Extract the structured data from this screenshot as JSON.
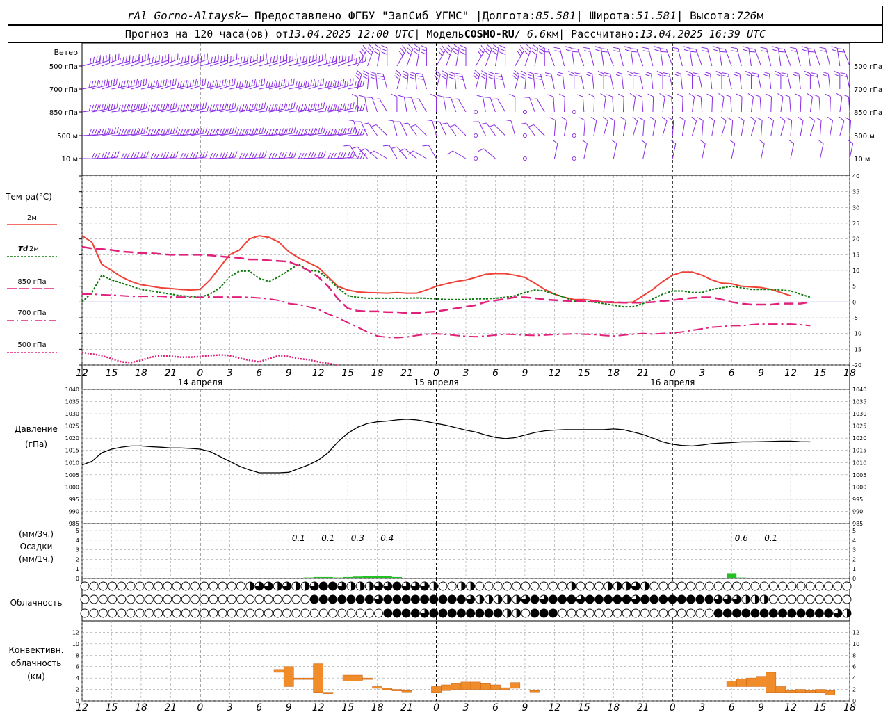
{
  "header": {
    "line1": {
      "station": "rAl_Gorno-Altaysk",
      "provider": " — Предоставлено ФГБУ \"ЗапСиб УГМС\" | ",
      "lon_label": "Долгота: ",
      "lon": "85.581",
      "lat_label": " | Широта: ",
      "lat": "51.581",
      "alt_label": " | Высота: ",
      "alt": "726",
      "alt_unit": "м"
    },
    "line2": {
      "forecast_label": "Прогноз на 120 часа(ов) от ",
      "forecast_time": "13.04.2025 12:00 UTC",
      "model_label": " | Модель ",
      "model": "COSMO-RU",
      "res": " / 6.6",
      "res_unit": "км",
      "computed_label": " | Рассчитано: ",
      "computed_time": "13.04.2025 16:39 UTC"
    }
  },
  "colors": {
    "wind": "#8a2be2",
    "t2m": "#ef4136",
    "td2m": "#0a7a0a",
    "t850": "#e0207a",
    "t700": "#e0207a",
    "t500": "#e0207a",
    "pressure": "#000000",
    "precip": "#22c022",
    "conv": "#f08c2a",
    "zero": "#5050e0",
    "grid": "#a0a0a0"
  },
  "hour_axis": {
    "ticks": [
      "12",
      "15",
      "18",
      "21",
      "0",
      "3",
      "6",
      "9",
      "12",
      "15",
      "18",
      "21",
      "0",
      "3",
      "6",
      "9",
      "12",
      "15",
      "18",
      "21",
      "0",
      "3",
      "6",
      "9",
      "12",
      "15",
      "18"
    ],
    "days": [
      {
        "label": "14 апреля",
        "at": 12
      },
      {
        "label": "15 апреля",
        "at": 36
      },
      {
        "label": "16 апреля",
        "at": 60
      }
    ]
  },
  "wind_panel": {
    "title": "Ветер",
    "levels": [
      "500 гПа",
      "700 гПа",
      "850 гПа",
      "500 м",
      "10  м"
    ],
    "right_levels": [
      "500 гПа",
      "700 гПа",
      "850 гПа",
      "500 м",
      "10  м"
    ]
  },
  "temp_panel": {
    "title": "Тем-ра(°C)",
    "ylim": [
      -20,
      40
    ],
    "ticks": [
      "40",
      "35",
      "30",
      "25",
      "20",
      "15",
      "10",
      "5",
      "0",
      "-5",
      "-10",
      "-15",
      "-20"
    ],
    "legend": [
      {
        "label": "2м",
        "style": "solid"
      },
      {
        "label_a": "Td",
        "label_b": " 2м",
        "style": "dotted"
      },
      {
        "label": "850 гПа",
        "style": "dashed"
      },
      {
        "label": "700 гПа",
        "style": "dashdot"
      },
      {
        "label": "500 гПа",
        "style": "dotted_fine"
      }
    ]
  },
  "pressure_panel": {
    "title": "Давление",
    "units": "(гПа)",
    "ylim": [
      985,
      1040
    ],
    "ticks": [
      "1040",
      "1035",
      "1030",
      "1025",
      "1020",
      "1015",
      "1010",
      "1005",
      "1000",
      "995",
      "990",
      "985"
    ]
  },
  "precip_panel": {
    "unit_top": "(мм/3ч.)",
    "title": "Осадки",
    "unit_bottom": "(мм/1ч.)",
    "ticks": [
      "5",
      "4",
      "3",
      "2",
      "1",
      "0"
    ],
    "labels": [
      {
        "h": 22,
        "text": "0.1"
      },
      {
        "h": 25,
        "text": "0.1"
      },
      {
        "h": 28,
        "text": "0.3"
      },
      {
        "h": 31,
        "text": "0.4"
      },
      {
        "h": 67,
        "text": "0.6"
      },
      {
        "h": 70,
        "text": "0.1"
      }
    ]
  },
  "cloud_panel": {
    "title": "Облачность"
  },
  "conv_panel": {
    "title_a": "Конвективн.",
    "title_b": "облачность",
    "units": "(км)",
    "ylim": [
      0,
      14
    ],
    "ticks": [
      "12",
      "10",
      "8",
      "6",
      "4",
      "2",
      "0"
    ]
  },
  "chart_data": {
    "type": "line",
    "x_hours_from": "13.04.2025 12:00 UTC",
    "t2m": {
      "x": [
        0,
        1,
        2,
        3,
        4,
        5,
        6,
        7,
        8,
        9,
        10,
        11,
        12,
        13,
        14,
        15,
        16,
        17,
        18,
        19,
        20,
        21,
        22,
        23,
        24,
        25,
        26,
        27,
        28,
        29,
        30,
        31,
        32,
        33,
        34,
        35,
        36,
        37,
        38,
        39,
        40,
        41,
        42,
        43,
        44,
        45,
        46,
        47,
        48,
        49,
        50,
        51,
        52,
        53,
        54,
        55,
        56,
        57,
        58,
        59,
        60,
        61,
        62,
        63,
        64,
        65,
        66,
        67,
        68,
        69,
        70,
        71,
        72,
        73,
        74,
        75,
        76,
        77,
        78
      ],
      "y": [
        21,
        19,
        12,
        10,
        8,
        6.5,
        5.5,
        5,
        4.5,
        4.3,
        4,
        3.8,
        4,
        7,
        11,
        15,
        16.5,
        20,
        21,
        20.5,
        19,
        16,
        14,
        12.5,
        11,
        8,
        5,
        3.8,
        3.2,
        3,
        2.9,
        2.8,
        3,
        2.8,
        2.8,
        3.8,
        5,
        5.8,
        6.5,
        7,
        7.8,
        8.8,
        9,
        9,
        8.5,
        7.8,
        6,
        4,
        2.5,
        1.5,
        0.8,
        0.8,
        0.5,
        0,
        -0.2,
        -0.2,
        0,
        2,
        4,
        6.5,
        8.5,
        9.5,
        9.5,
        8.5,
        7,
        6,
        5.8,
        5,
        4.8,
        4.6,
        4,
        3,
        2
      ]
    },
    "td2m": {
      "y": [
        0,
        3,
        8.5,
        7,
        6,
        5,
        4,
        3.5,
        3,
        2.5,
        2,
        1.8,
        1.5,
        2.5,
        4.5,
        8,
        9.8,
        9.8,
        7.5,
        6.5,
        8,
        10,
        12,
        10,
        9.8,
        7.5,
        4.5,
        2,
        1.5,
        1.2,
        1.2,
        1.2,
        1.2,
        1.2,
        1.3,
        1.2,
        1,
        0.8,
        0.8,
        0.8,
        1,
        1,
        1.2,
        1.5,
        2,
        3,
        3.8,
        3.5,
        2.5,
        1.5,
        0.3,
        0.1,
        0,
        -0.5,
        -1,
        -1.5,
        -1.5,
        -0.5,
        1,
        2.5,
        3.5,
        3.5,
        3,
        3,
        4,
        4.5,
        5,
        4.5,
        4,
        4,
        4,
        3.8,
        3.5,
        2.5,
        1.5
      ]
    },
    "t850": {
      "y": [
        17.5,
        17,
        16.8,
        16.5,
        16,
        15.8,
        15.5,
        15.5,
        15.2,
        15,
        15,
        15,
        15,
        14.8,
        14.5,
        14.2,
        14,
        13.5,
        13.5,
        13.2,
        13,
        12.8,
        11.5,
        10,
        8,
        5,
        1,
        -2,
        -2.8,
        -3,
        -3,
        -3.2,
        -3.2,
        -3.5,
        -3.5,
        -3.2,
        -3,
        -2.5,
        -2,
        -1.5,
        -1,
        0,
        0.5,
        1,
        1.5,
        1.5,
        1.2,
        0.8,
        0.6,
        0.4,
        0.3,
        0.2,
        0.2,
        0,
        0,
        -0.2,
        -0.2,
        -0.2,
        0,
        0.3,
        0.6,
        1,
        1.3,
        1.5,
        1.5,
        0.8,
        0,
        -0.5,
        -0.8,
        -0.8,
        -0.8,
        -0.5,
        -0.5,
        -0.5,
        0
      ]
    },
    "t700": {
      "y": [
        2.5,
        2.5,
        2.3,
        2.2,
        2,
        1.8,
        1.8,
        1.8,
        1.8,
        1.6,
        1.6,
        1.5,
        1.5,
        1.6,
        1.6,
        1.6,
        1.6,
        1.5,
        1.3,
        1,
        0.5,
        -0.5,
        -0.8,
        -1.5,
        -2.3,
        -3.8,
        -5,
        -6.5,
        -8,
        -9.5,
        -10.8,
        -11.2,
        -11.3,
        -11.1,
        -10.6,
        -10.2,
        -10.1,
        -10.3,
        -10.6,
        -10.9,
        -11,
        -10.8,
        -10.5,
        -10.2,
        -10.3,
        -10.5,
        -10.6,
        -10.5,
        -10.3,
        -10.2,
        -10.1,
        -10.2,
        -10.3,
        -10.6,
        -10.8,
        -10.5,
        -10.2,
        -10,
        -10.2,
        -10,
        -9.8,
        -9.5,
        -9,
        -8.5,
        -8,
        -7.8,
        -7.5,
        -7.5,
        -7.2,
        -7,
        -7,
        -7,
        -7,
        -7.2,
        -7.5
      ]
    },
    "t500": {
      "y": [
        -16,
        -16.5,
        -17,
        -18,
        -19,
        -19.2,
        -18.5,
        -17.5,
        -17,
        -17.2,
        -17.5,
        -17.5,
        -17.3,
        -17,
        -16.8,
        -17,
        -17.8,
        -18.5,
        -19,
        -18,
        -17,
        -17.3,
        -18,
        -18.3,
        -19,
        -19.5,
        -20
      ]
    },
    "pressure": {
      "y": [
        1009,
        1010.5,
        1014,
        1015.5,
        1016.3,
        1016.8,
        1016.8,
        1016.5,
        1016.3,
        1016,
        1016,
        1015.8,
        1015.5,
        1014.5,
        1012.5,
        1010.5,
        1008.5,
        1007,
        1005.8,
        1005.8,
        1005.8,
        1006,
        1007.5,
        1009,
        1011,
        1014,
        1018.5,
        1022,
        1024.5,
        1026,
        1026.7,
        1027,
        1027.5,
        1027.8,
        1027.5,
        1026.8,
        1026,
        1025.3,
        1024.3,
        1023.3,
        1022.5,
        1021.3,
        1020.3,
        1019.8,
        1020.2,
        1021.3,
        1022.3,
        1023,
        1023.3,
        1023.5,
        1023.5,
        1023.5,
        1023.5,
        1023.5,
        1023.8,
        1023.5,
        1022.5,
        1021.5,
        1020,
        1018.5,
        1017.5,
        1017,
        1016.8,
        1017.2,
        1017.8,
        1018,
        1018.2,
        1018.5,
        1018.5,
        1018.6,
        1018.7,
        1018.8,
        1018.8,
        1018.6,
        1018.5
      ]
    },
    "precip_3h": [
      {
        "h": 21,
        "v": 0.05
      },
      {
        "h": 22,
        "v": 0.05
      },
      {
        "h": 23,
        "v": 0.1
      },
      {
        "h": 24,
        "v": 0.15
      },
      {
        "h": 25,
        "v": 0.15
      },
      {
        "h": 26,
        "v": 0.1
      },
      {
        "h": 27,
        "v": 0.15
      },
      {
        "h": 28,
        "v": 0.2
      },
      {
        "h": 29,
        "v": 0.25
      },
      {
        "h": 30,
        "v": 0.25
      },
      {
        "h": 31,
        "v": 0.25
      },
      {
        "h": 32,
        "v": 0.15
      },
      {
        "h": 33,
        "v": 0.05
      },
      {
        "h": 66,
        "v": 0.55
      },
      {
        "h": 67,
        "v": 0.1
      }
    ],
    "cloud_rows": [
      "000000000000000000122121123321112232221001100000000001000111210000000000000000000000",
      "000000000000000000000000033333332333333333211111232333233333233333333222111000000000",
      "000000000000000000000000000000000333323333333311033300000000000000000333333333333321"
    ],
    "conv_bars": [
      {
        "h": 20,
        "h1": 5,
        "h2": 5.5
      },
      {
        "h": 21,
        "h1": 2.5,
        "h2": 6
      },
      {
        "h": 22,
        "h1": 4,
        "h2": 4
      },
      {
        "h": 23,
        "h1": 4,
        "h2": 4
      },
      {
        "h": 24,
        "h1": 1.5,
        "h2": 6.5
      },
      {
        "h": 25,
        "h1": 1.5,
        "h2": 1.5
      },
      {
        "h": 27,
        "h1": 3.5,
        "h2": 4.5
      },
      {
        "h": 28,
        "h1": 3.5,
        "h2": 4.5
      },
      {
        "h": 29,
        "h1": 3.8,
        "h2": 4
      },
      {
        "h": 30,
        "h1": 2.2,
        "h2": 2.5
      },
      {
        "h": 31,
        "h1": 2,
        "h2": 2.2
      },
      {
        "h": 32,
        "h1": 2,
        "h2": 2
      },
      {
        "h": 33,
        "h1": 1.8,
        "h2": 1.8
      },
      {
        "h": 36,
        "h1": 1.5,
        "h2": 2.5
      },
      {
        "h": 37,
        "h1": 1.8,
        "h2": 2.8
      },
      {
        "h": 38,
        "h1": 2,
        "h2": 3
      },
      {
        "h": 39,
        "h1": 2,
        "h2": 3.3
      },
      {
        "h": 40,
        "h1": 2,
        "h2": 3.3
      },
      {
        "h": 41,
        "h1": 2,
        "h2": 3
      },
      {
        "h": 42,
        "h1": 2,
        "h2": 2.8
      },
      {
        "h": 43,
        "h1": 2,
        "h2": 2.3
      },
      {
        "h": 44,
        "h1": 2.2,
        "h2": 3.2
      },
      {
        "h": 46,
        "h1": 1.8,
        "h2": 1.8
      },
      {
        "h": 66,
        "h1": 2.5,
        "h2": 3.5
      },
      {
        "h": 67,
        "h1": 2.5,
        "h2": 3.8
      },
      {
        "h": 68,
        "h1": 2.5,
        "h2": 4
      },
      {
        "h": 69,
        "h1": 2.5,
        "h2": 4.3
      },
      {
        "h": 70,
        "h1": 1.5,
        "h2": 5
      },
      {
        "h": 71,
        "h1": 1.5,
        "h2": 2.5
      },
      {
        "h": 72,
        "h1": 1.5,
        "h2": 1.8
      },
      {
        "h": 73,
        "h1": 1.5,
        "h2": 2
      },
      {
        "h": 74,
        "h1": 1.5,
        "h2": 1.8
      },
      {
        "h": 75,
        "h1": 1.5,
        "h2": 2
      },
      {
        "h": 76,
        "h1": 1,
        "h2": 1.8
      }
    ]
  }
}
